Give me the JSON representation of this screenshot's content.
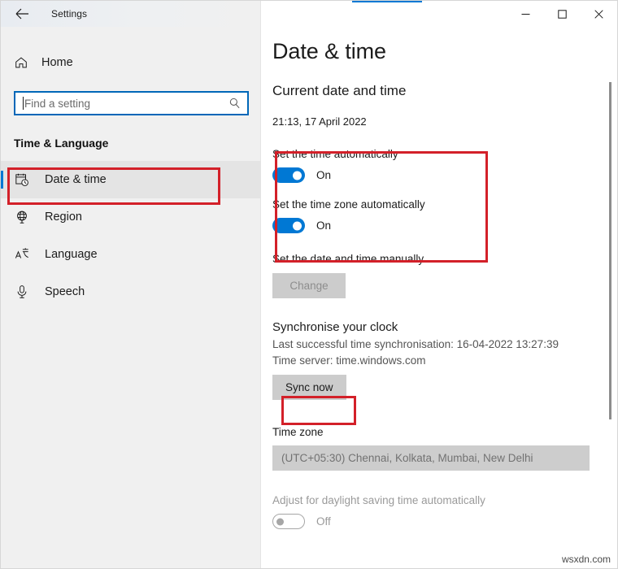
{
  "window": {
    "title": "Settings",
    "back_icon": "back-arrow-icon",
    "controls": {
      "minimize": "minimize-icon",
      "maximize": "maximize-icon",
      "close": "close-icon"
    }
  },
  "sidebar": {
    "home": {
      "label": "Home",
      "icon": "home-icon"
    },
    "search": {
      "value": "",
      "placeholder": "Find a setting",
      "icon": "search-icon"
    },
    "section_title": "Time & Language",
    "items": [
      {
        "label": "Date & time",
        "icon": "calendar-clock-icon",
        "selected": true
      },
      {
        "label": "Region",
        "icon": "globe-icon",
        "selected": false
      },
      {
        "label": "Language",
        "icon": "language-icon",
        "selected": false
      },
      {
        "label": "Speech",
        "icon": "microphone-icon",
        "selected": false
      }
    ]
  },
  "main": {
    "page_title": "Date & time",
    "current_section": {
      "heading": "Current date and time",
      "value": "21:13, 17 April 2022"
    },
    "set_time_auto": {
      "label": "Set the time automatically",
      "state": "On",
      "on": true
    },
    "set_timezone_auto": {
      "label": "Set the time zone automatically",
      "state": "On",
      "on": true
    },
    "manual": {
      "label": "Set the date and time manually",
      "button": "Change",
      "disabled": true
    },
    "sync": {
      "heading": "Synchronise your clock",
      "last_sync": "Last successful time synchronisation: 16-04-2022 13:27:39",
      "time_server": "Time server: time.windows.com",
      "button": "Sync now"
    },
    "timezone": {
      "label": "Time zone",
      "selected": "(UTC+05:30) Chennai, Kolkata, Mumbai, New Delhi"
    },
    "daylight": {
      "label": "Adjust for daylight saving time automatically",
      "state": "Off",
      "on": false
    }
  },
  "watermark": "wsxdn.com",
  "colors": {
    "accent": "#0078d4",
    "highlight": "#d32029",
    "search_border": "#0067b8"
  }
}
